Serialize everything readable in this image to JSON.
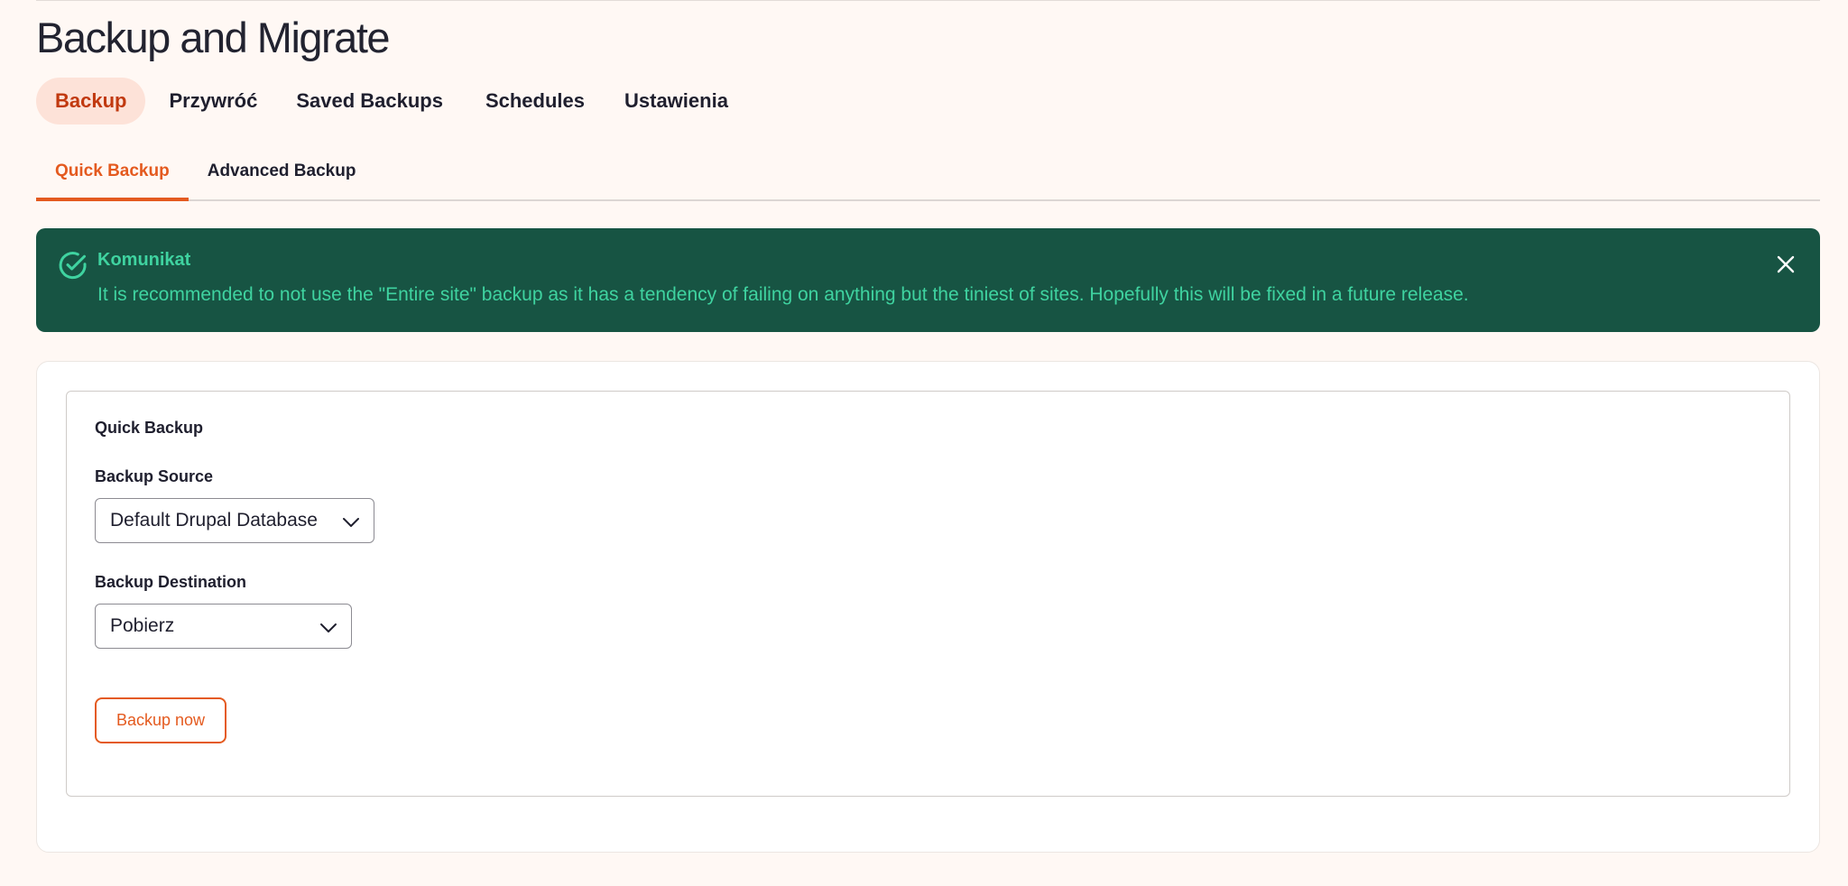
{
  "page": {
    "title": "Backup and Migrate"
  },
  "primary_tabs": [
    {
      "label": "Backup",
      "active": true
    },
    {
      "label": "Przywróć",
      "active": false
    },
    {
      "label": "Saved Backups",
      "active": false
    },
    {
      "label": "Schedules",
      "active": false
    },
    {
      "label": "Ustawienia",
      "active": false
    }
  ],
  "secondary_tabs": [
    {
      "label": "Quick Backup",
      "active": true
    },
    {
      "label": "Advanced Backup",
      "active": false
    }
  ],
  "message": {
    "title": "Komunikat",
    "text": "It is recommended to not use the \"Entire site\" backup as it has a tendency of failing on anything but the tiniest of sites. Hopefully this will be fixed in a future release.",
    "icon": "check-circle-icon",
    "close_icon": "close-icon"
  },
  "form": {
    "legend": "Quick Backup",
    "source": {
      "label": "Backup Source",
      "value": "Default Drupal Database"
    },
    "destination": {
      "label": "Backup Destination",
      "value": "Pobierz"
    },
    "submit_label": "Backup now"
  },
  "colors": {
    "accent": "#e45a1f",
    "active_tab_bg": "#fde2d8",
    "message_bg": "#175443",
    "message_text": "#3fd3a0",
    "page_bg": "#fff8f4"
  }
}
